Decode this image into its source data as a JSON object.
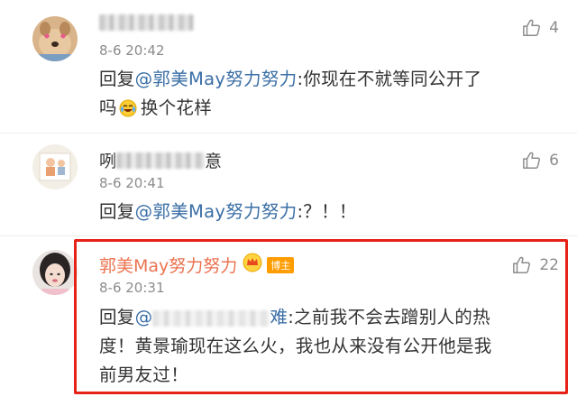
{
  "comments": [
    {
      "time": "8-6 20:42",
      "likes": "4",
      "reply_prefix": "回复",
      "mention": "@郭美May努力努力",
      "text_line1": ":你现在不就等同公开了",
      "text_line2_a": "吗",
      "emoji_icon": "laughing-crying-emoji",
      "text_line2_b": "换个花样"
    },
    {
      "name_prefix": "咧",
      "name_suffix": "意",
      "time": "8-6 20:41",
      "likes": "6",
      "reply_prefix": "回复",
      "mention": "@郭美May努力努力",
      "text": ":？！！"
    },
    {
      "name": "郭美May努力努力",
      "badge": "博主",
      "time": "8-6 20:31",
      "likes": "22",
      "reply_prefix": "回复",
      "mention": "@",
      "mention_suffix": "难",
      "text_line1": ":之前我不会去蹭别人的热",
      "text_line2": "度！黄景瑜现在这么火，我也从来没有公开他是我",
      "text_line3": "前男友过！"
    }
  ],
  "colors": {
    "username_blogger": "#eb7350",
    "mention": "#3a6ea5",
    "highlight_border": "#e62117",
    "badge": "#ff9c00"
  }
}
